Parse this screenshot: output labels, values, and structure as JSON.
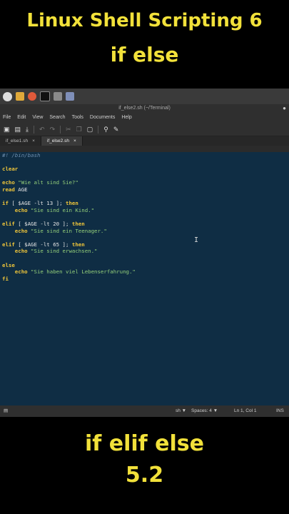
{
  "captions": {
    "top_title": "Linux Shell Scripting 6",
    "top_sub": "if else",
    "bottom_1": "if elif else",
    "bottom_2": "5.2"
  },
  "window": {
    "title": "if_else2.sh (~/Terminal)",
    "close": "●"
  },
  "menu": [
    "File",
    "Edit",
    "View",
    "Search",
    "Tools",
    "Documents",
    "Help"
  ],
  "tabs": [
    {
      "label": "if_else1.sh",
      "close": "×"
    },
    {
      "label": "if_else2.sh",
      "close": "×"
    }
  ],
  "code": {
    "l1": "#! /bin/bash",
    "l2": "clear",
    "l3a": "echo ",
    "l3b": "\"Wie alt sind Sie?\"",
    "l4a": "read ",
    "l4b": "AGE",
    "l5a": "if",
    "l5b": " [ $AGE -lt 13 ]; ",
    "l5c": "then",
    "l6a": "    echo ",
    "l6b": "\"Sie sind ein Kind.\"",
    "l7a": "elif",
    "l7b": " [ $AGE -lt 20 ]; ",
    "l7c": "then",
    "l8a": "    echo ",
    "l8b": "\"Sie sind ein Teenager.\"",
    "l9a": "elif",
    "l9b": " [ $AGE -lt 65 ]; ",
    "l9c": "then",
    "l10a": "    echo ",
    "l10b": "\"Sie sind erwachsen.\"",
    "l11": "else",
    "l12a": "    echo ",
    "l12b": "\"Sie haben viel Lebenserfahrung.\"",
    "l13": "fi"
  },
  "status": {
    "lang": "sh ▼",
    "spaces": "Spaces: 4 ▼",
    "position": "Ln 1, Col 1",
    "mode": "INS"
  },
  "colors": {
    "caption": "#f2e13a",
    "editor_bg": "#0f2d44",
    "keyword": "#f0c63a",
    "string": "#95d07a"
  }
}
